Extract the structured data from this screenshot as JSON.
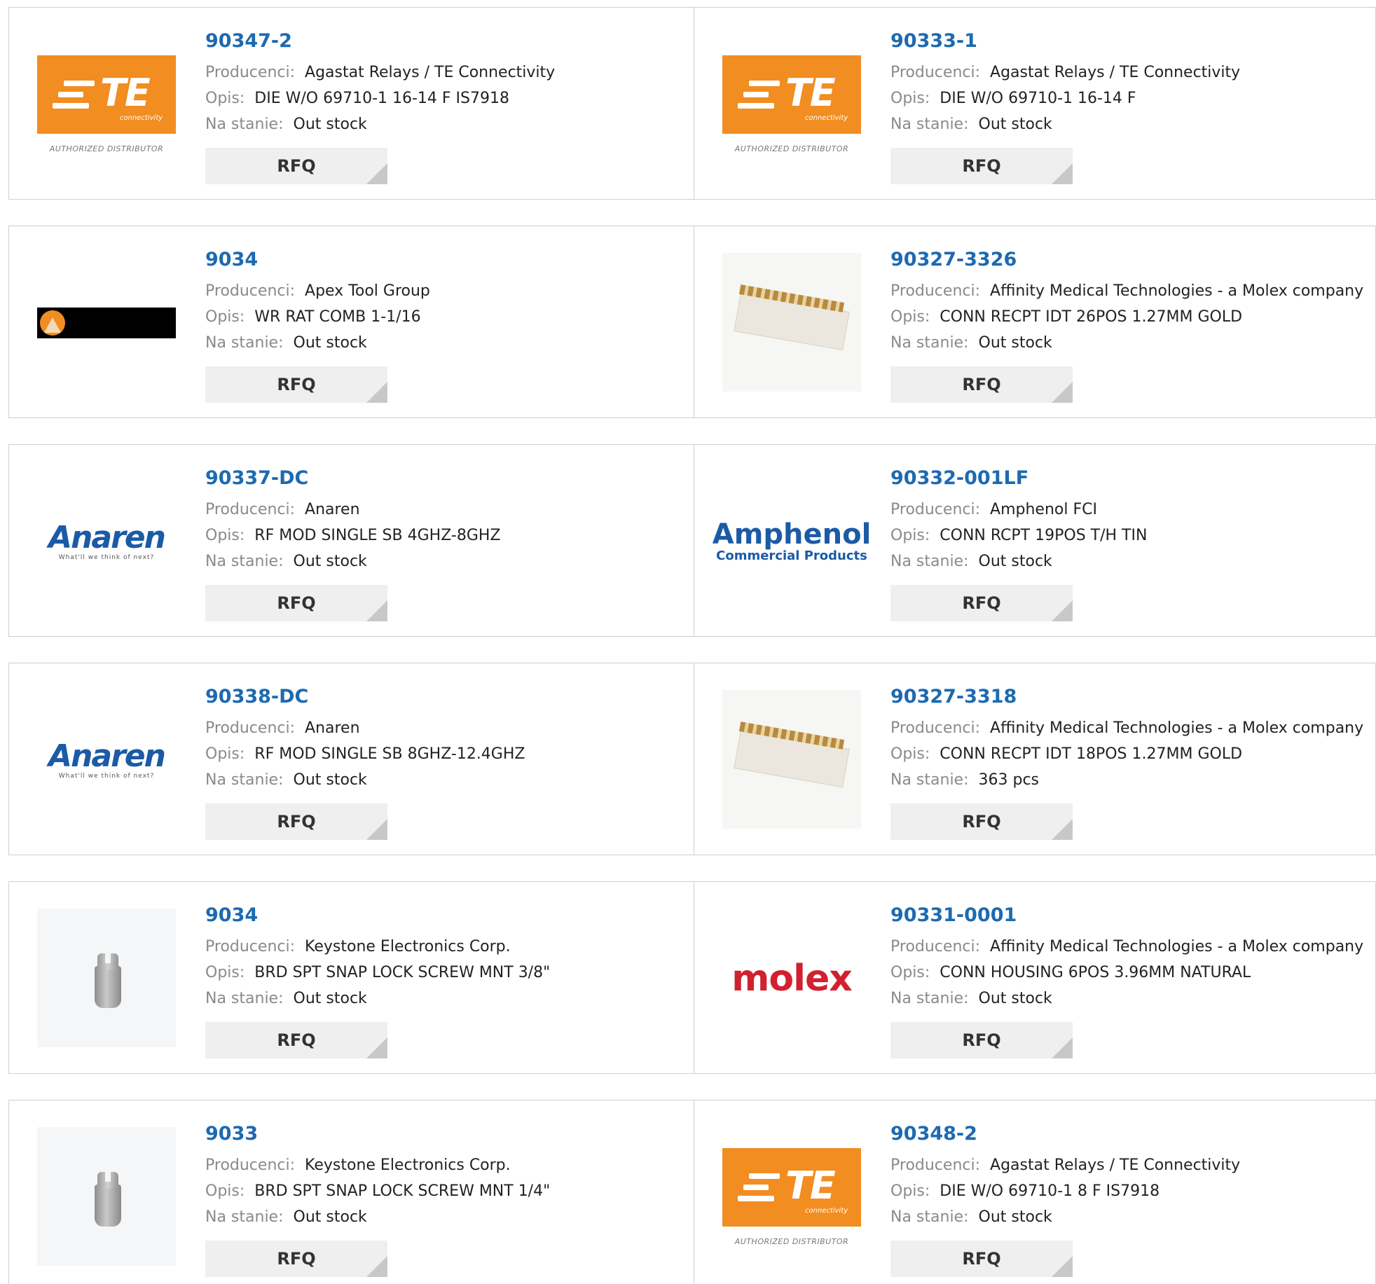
{
  "labels": {
    "manufacturer": "Producenci:",
    "description": "Opis:",
    "stock": "Na stanie:",
    "rfq": "RFQ"
  },
  "logos": {
    "te": {
      "brand": "TE",
      "sub": "connectivity",
      "caption": "AUTHORIZED DISTRIBUTOR"
    },
    "anaren": {
      "brand": "Anaren",
      "tagline": "What'll we think of next?"
    },
    "amphenol": {
      "brand": "Amphenol",
      "sub": "Commercial Products"
    },
    "molex": {
      "brand": "molex"
    }
  },
  "products": [
    {
      "part": "90347-2",
      "manufacturer": "Agastat Relays / TE Connectivity",
      "description": "DIE W/O 69710-1 16-14 F IS7918",
      "stock": "Out stock",
      "logo": "te-logo"
    },
    {
      "part": "90333-1",
      "manufacturer": "Agastat Relays / TE Connectivity",
      "description": "DIE W/O 69710-1 16-14 F",
      "stock": "Out stock",
      "logo": "te-logo"
    },
    {
      "part": "9034",
      "manufacturer": "Apex Tool Group",
      "description": "WR RAT COMB 1-1/16",
      "stock": "Out stock",
      "logo": "apex-logo"
    },
    {
      "part": "90327-3326",
      "manufacturer": "Affinity Medical Technologies - a Molex company",
      "description": "CONN RECPT IDT 26POS 1.27MM GOLD",
      "stock": "Out stock",
      "logo": "connector-photo"
    },
    {
      "part": "90337-DC",
      "manufacturer": "Anaren",
      "description": "RF MOD SINGLE SB 4GHZ-8GHZ",
      "stock": "Out stock",
      "logo": "anaren-logo"
    },
    {
      "part": "90332-001LF",
      "manufacturer": "Amphenol FCI",
      "description": "CONN RCPT 19POS T/H TIN",
      "stock": "Out stock",
      "logo": "amphenol-logo"
    },
    {
      "part": "90338-DC",
      "manufacturer": "Anaren",
      "description": "RF MOD SINGLE SB 8GHZ-12.4GHZ",
      "stock": "Out stock",
      "logo": "anaren-logo"
    },
    {
      "part": "90327-3318",
      "manufacturer": "Affinity Medical Technologies - a Molex company",
      "description": "CONN RECPT IDT 18POS 1.27MM GOLD",
      "stock": "363 pcs",
      "logo": "connector-photo"
    },
    {
      "part": "9034",
      "manufacturer": "Keystone Electronics Corp.",
      "description": "BRD SPT SNAP LOCK SCREW MNT 3/8\"",
      "stock": "Out stock",
      "logo": "screw-photo"
    },
    {
      "part": "90331-0001",
      "manufacturer": "Affinity Medical Technologies - a Molex company",
      "description": "CONN HOUSING 6POS 3.96MM NATURAL",
      "stock": "Out stock",
      "logo": "molex-logo"
    },
    {
      "part": "9033",
      "manufacturer": "Keystone Electronics Corp.",
      "description": "BRD SPT SNAP LOCK SCREW MNT 1/4\"",
      "stock": "Out stock",
      "logo": "screw-photo"
    },
    {
      "part": "90348-2",
      "manufacturer": "Agastat Relays / TE Connectivity",
      "description": "DIE W/O 69710-1 8 F IS7918",
      "stock": "Out stock",
      "logo": "te-logo"
    }
  ]
}
